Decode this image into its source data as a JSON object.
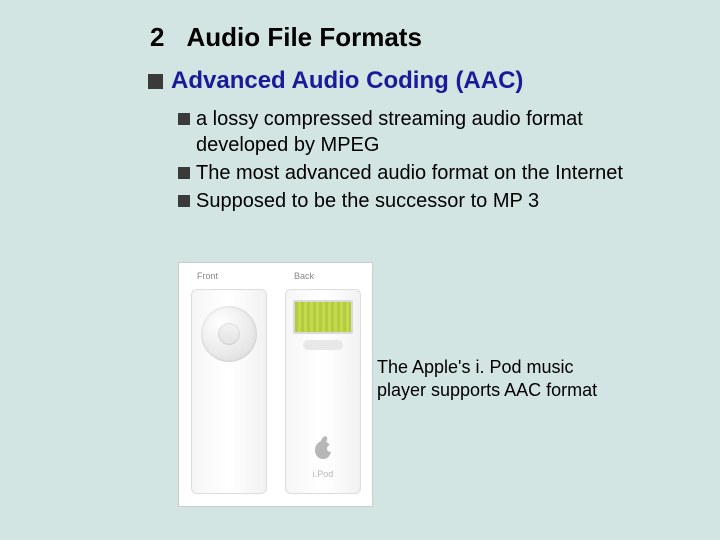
{
  "section": {
    "number": "2",
    "title": "Audio File Formats"
  },
  "heading": {
    "text": "Advanced Audio Coding (AAC)"
  },
  "bullets": [
    "a lossy compressed streaming audio format developed by MPEG",
    "The most advanced audio format on the Internet",
    "Supposed to be the successor to MP 3"
  ],
  "image": {
    "front_label": "Front",
    "back_label": "Back",
    "brand": "i.Pod"
  },
  "caption": "The Apple's i. Pod music player supports AAC format"
}
